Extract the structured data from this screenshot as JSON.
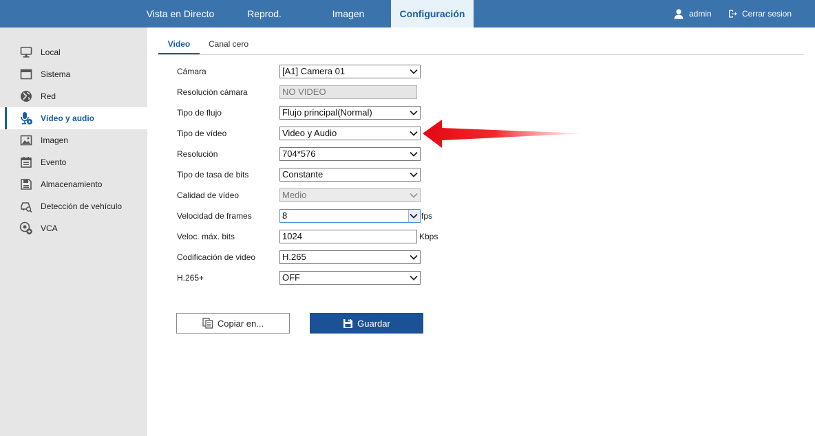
{
  "nav": {
    "items": [
      {
        "label": "Vista en Directo"
      },
      {
        "label": "Reprod."
      },
      {
        "label": "Imagen"
      },
      {
        "label": "Configuración",
        "active": true
      }
    ],
    "user_label": "admin",
    "logout_label": "Cerrar sesion"
  },
  "sidebar": {
    "items": [
      {
        "label": "Local",
        "icon": "monitor-icon"
      },
      {
        "label": "Sistema",
        "icon": "window-icon"
      },
      {
        "label": "Red",
        "icon": "globe-icon"
      },
      {
        "label": "Vídeo y audio",
        "icon": "microphone-icon",
        "active": true
      },
      {
        "label": "Imagen",
        "icon": "image-icon"
      },
      {
        "label": "Evento",
        "icon": "calendar-icon"
      },
      {
        "label": "Almacenamiento",
        "icon": "storage-icon"
      },
      {
        "label": "Detección de vehículo",
        "icon": "vehicle-search-icon"
      },
      {
        "label": "VCA",
        "icon": "vca-icon"
      }
    ]
  },
  "tabs": [
    {
      "label": "Video",
      "active": true
    },
    {
      "label": "Canal cero"
    }
  ],
  "form": {
    "camera": {
      "label": "Cámara",
      "value": "[A1] Camera 01"
    },
    "camera_resolution": {
      "label": "Resolución cámara",
      "value": "NO VIDEO"
    },
    "stream_type": {
      "label": "Tipo de flujo",
      "value": "Flujo principal(Normal)"
    },
    "video_type": {
      "label": "Tipo de vídeo",
      "value": "Video y Audio"
    },
    "resolution": {
      "label": "Resolución",
      "value": "704*576"
    },
    "bitrate_type": {
      "label": "Tipo de tasa de bits",
      "value": "Constante"
    },
    "video_quality": {
      "label": "Calidad de vídeo",
      "value": "Medio"
    },
    "frame_rate": {
      "label": "Velocidad de frames",
      "value": "8",
      "unit": "fps"
    },
    "max_bitrate": {
      "label": "Veloc. máx. bits",
      "value": "1024",
      "unit": "Kbps"
    },
    "video_encoding": {
      "label": "Codificación de video",
      "value": "H.265"
    },
    "h265_plus": {
      "label": "H.265+",
      "value": "OFF"
    }
  },
  "buttons": {
    "copy_label": "Copiar en...",
    "save_label": "Guardar"
  },
  "colors": {
    "topbar": "#3b73ad",
    "accent": "#1b5fa1",
    "save_button": "#1b5295",
    "annotation_arrow": "#e30613"
  }
}
